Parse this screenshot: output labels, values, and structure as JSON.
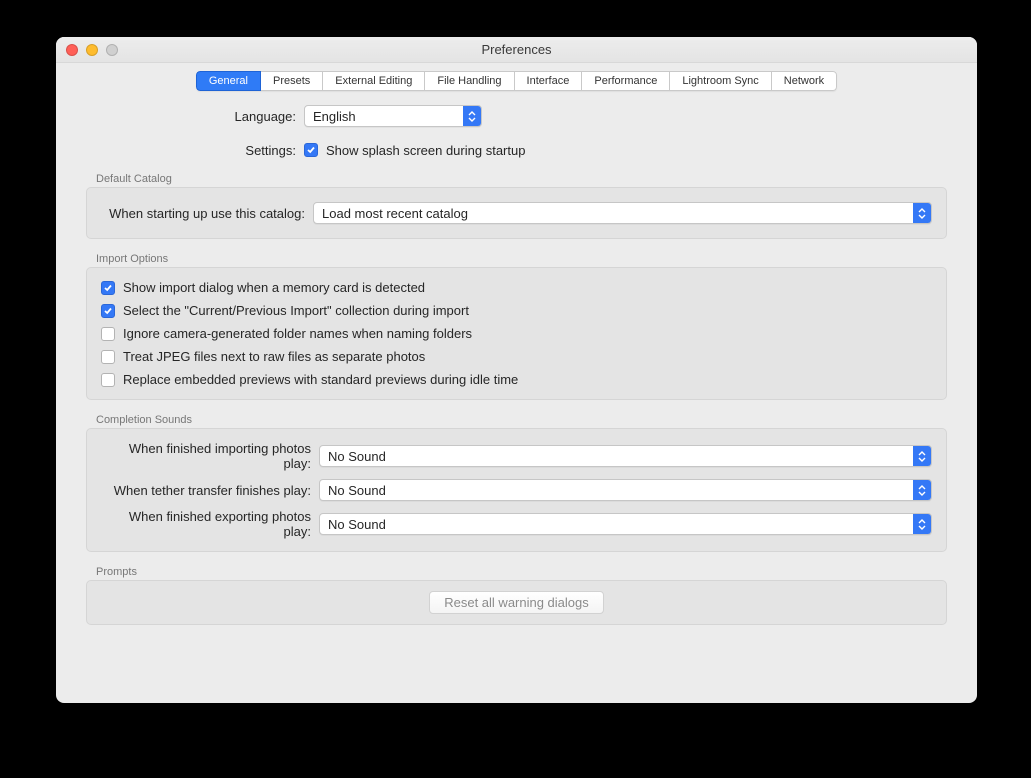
{
  "window": {
    "title": "Preferences"
  },
  "tabs": [
    "General",
    "Presets",
    "External Editing",
    "File Handling",
    "Interface",
    "Performance",
    "Lightroom Sync",
    "Network"
  ],
  "activeTab": 0,
  "top": {
    "languageLabel": "Language:",
    "languageValue": "English",
    "settingsLabel": "Settings:",
    "splashChecked": true,
    "splashLabel": "Show splash screen during startup"
  },
  "defaultCatalog": {
    "section": "Default Catalog",
    "label": "When starting up use this catalog:",
    "value": "Load most recent catalog"
  },
  "importOptions": {
    "section": "Import Options",
    "items": [
      {
        "checked": true,
        "label": "Show import dialog when a memory card is detected"
      },
      {
        "checked": true,
        "label": "Select the \"Current/Previous Import\" collection during import"
      },
      {
        "checked": false,
        "label": "Ignore camera-generated folder names when naming folders"
      },
      {
        "checked": false,
        "label": "Treat JPEG files next to raw files as separate photos"
      },
      {
        "checked": false,
        "label": "Replace embedded previews with standard previews during idle time"
      }
    ]
  },
  "completion": {
    "section": "Completion Sounds",
    "rows": [
      {
        "label": "When finished importing photos play:",
        "value": "No Sound"
      },
      {
        "label": "When tether transfer finishes play:",
        "value": "No Sound"
      },
      {
        "label": "When finished exporting photos play:",
        "value": "No Sound"
      }
    ]
  },
  "prompts": {
    "section": "Prompts",
    "button": "Reset all warning dialogs"
  }
}
